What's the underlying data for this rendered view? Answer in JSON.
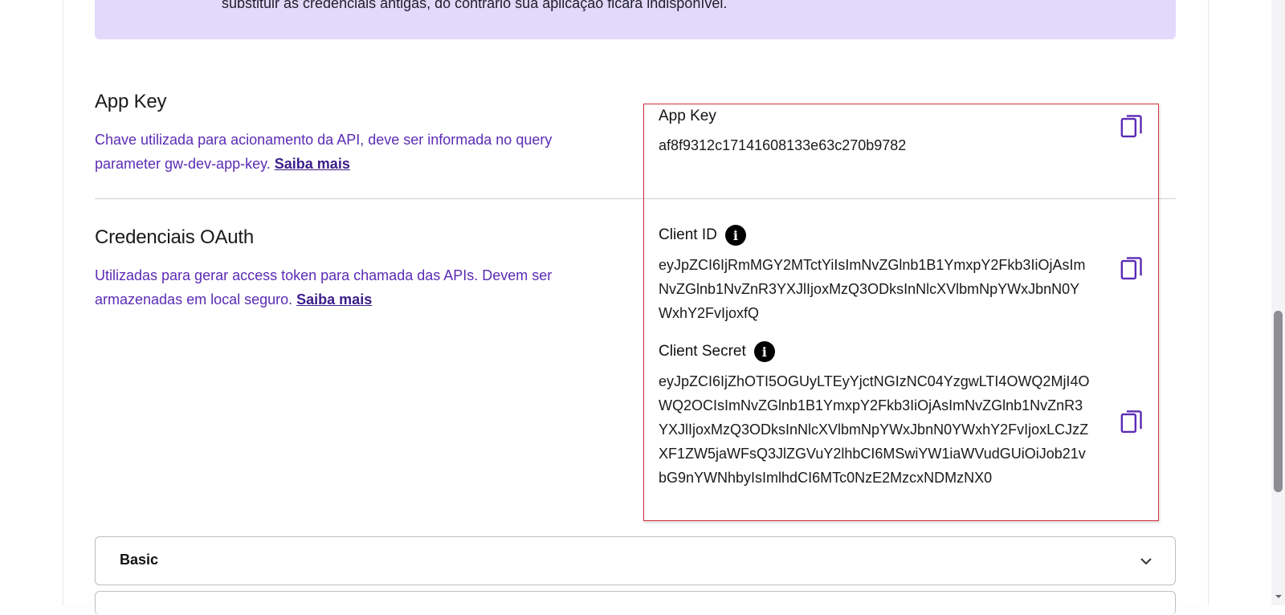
{
  "alert": {
    "text": "substituir as credenciais antigas, do contrário sua aplicação ficará indisponível."
  },
  "app_key_section": {
    "title": "App Key",
    "description": "Chave utilizada para acionamento da API, deve ser informada no query parameter gw-dev-app-key.",
    "link": "Saiba mais",
    "field_label": "App Key",
    "field_value": "af8f9312c17141608133e63c270b9782"
  },
  "oauth_section": {
    "title": "Credenciais OAuth",
    "description": "Utilizadas para gerar access token para chamada das APIs. Devem ser armazenadas em local seguro.",
    "link": "Saiba mais",
    "client_id_label": "Client ID",
    "client_id_value": "eyJpZCI6IjRmMGY2MTctYiIsImNvZGlnb1B1YmxpY2Fkb3IiOjAsImNvZGlnb1NvZnR3YXJlIjoxMzQ3ODksInNlcXVlbmNpYWxJbnN0YWxhY2FvIjoxfQ",
    "client_secret_label": "Client Secret",
    "client_secret_value": "eyJpZCI6IjZhOTI5OGUyLTEyYjctNGIzNC04YzgwLTI4OWQ2MjI4OWQ2OCIsImNvZGlnb1B1YmxpY2Fkb3IiOjAsImNvZGlnb1NvZnR3YXJlIjoxMzQ3ODksInNlcXVlbmNpYWxJbnN0YWxhY2FvIjoxLCJzZXF1ZW5jaWFsQ3JlZGVuY2lhbCI6MSwiYW1iaWVudGUiOiJob21vbG9nYWNhbyIsImlhdCI6MTc0NzE2MzcxNDMzNX0"
  },
  "accordion": {
    "label": "Basic"
  },
  "icons": {
    "copy": "copy-icon",
    "info": "info-icon",
    "chevron": "chevron-down-icon"
  },
  "colors": {
    "accent_purple": "#5b2bb5",
    "banner_bg": "#e3d9fb",
    "highlight_border": "#d0313a"
  }
}
